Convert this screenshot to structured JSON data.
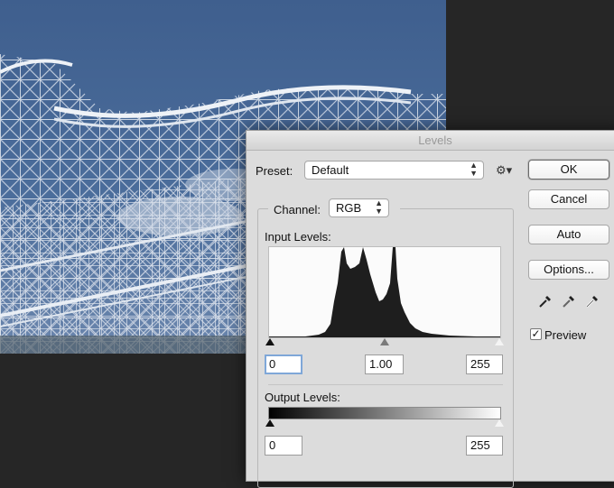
{
  "dialog": {
    "title": "Levels",
    "preset_label": "Preset:",
    "preset_value": "Default",
    "channel_label": "Channel:",
    "channel_value": "RGB",
    "input_levels_label": "Input Levels:",
    "output_levels_label": "Output Levels:",
    "input_black": "0",
    "input_gamma": "1.00",
    "input_white": "255",
    "output_black": "0",
    "output_white": "255",
    "buttons": {
      "ok": "OK",
      "cancel": "Cancel",
      "auto": "Auto",
      "options": "Options..."
    },
    "preview_label": "Preview",
    "preview_checked": true,
    "icons": [
      "gear-icon",
      "black-point-eyedropper-icon",
      "gray-point-eyedropper-icon",
      "white-point-eyedropper-icon"
    ]
  }
}
